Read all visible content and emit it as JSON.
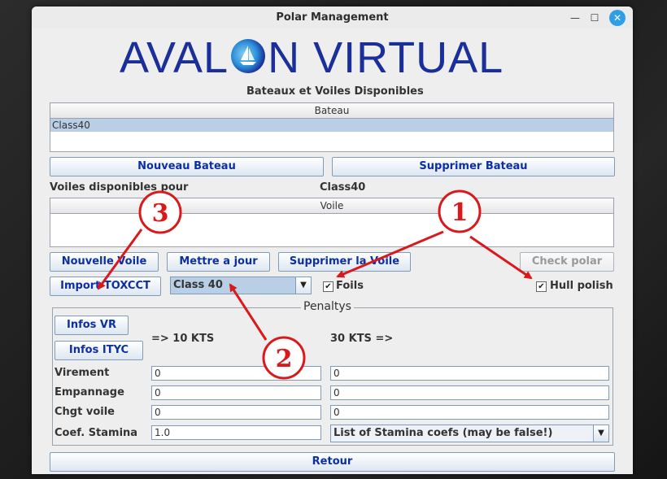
{
  "window": {
    "title": "Polar Management"
  },
  "logo": {
    "text_left": "AVAL",
    "text_right": "N VIRTUAL"
  },
  "boats": {
    "section_title": "Bateaux et Voiles Disponibles",
    "column_header": "Bateau",
    "rows": [
      "Class40"
    ],
    "new_button": "Nouveau Bateau",
    "delete_button": "Supprimer Bateau"
  },
  "sails": {
    "label": "Voiles disponibles pour",
    "selected_boat": "Class40",
    "column_header": "Voile",
    "new_button": "Nouvelle Voile",
    "update_button": "Mettre a jour",
    "delete_button": "Supprimer la Voile",
    "check_button": "Check polar",
    "import_button": "Import TOXCCT",
    "class_select": "Class 40",
    "foils_label": "Foils",
    "hull_label": "Hull polish",
    "foils_checked": true,
    "hull_checked": true
  },
  "penalties": {
    "title": "Penaltys",
    "infos_vr": "Infos VR",
    "infos_ityc": "Infos ITYC",
    "low_label": "=> 10 KTS",
    "high_label": "30 KTS =>",
    "rows": [
      {
        "label": "Virement",
        "low": "0",
        "high": "0"
      },
      {
        "label": "Empannage",
        "low": "0",
        "high": "0"
      },
      {
        "label": "Chgt voile",
        "low": "0",
        "high": "0"
      }
    ],
    "stamina_label": "Coef. Stamina",
    "stamina_value": "1.0",
    "stamina_select": "List of Stamina coefs (may be false!)"
  },
  "footer": {
    "return_button": "Retour"
  },
  "annotations": {
    "marker1": "1",
    "marker2": "2",
    "marker3": "3",
    "color": "#d9191c"
  }
}
